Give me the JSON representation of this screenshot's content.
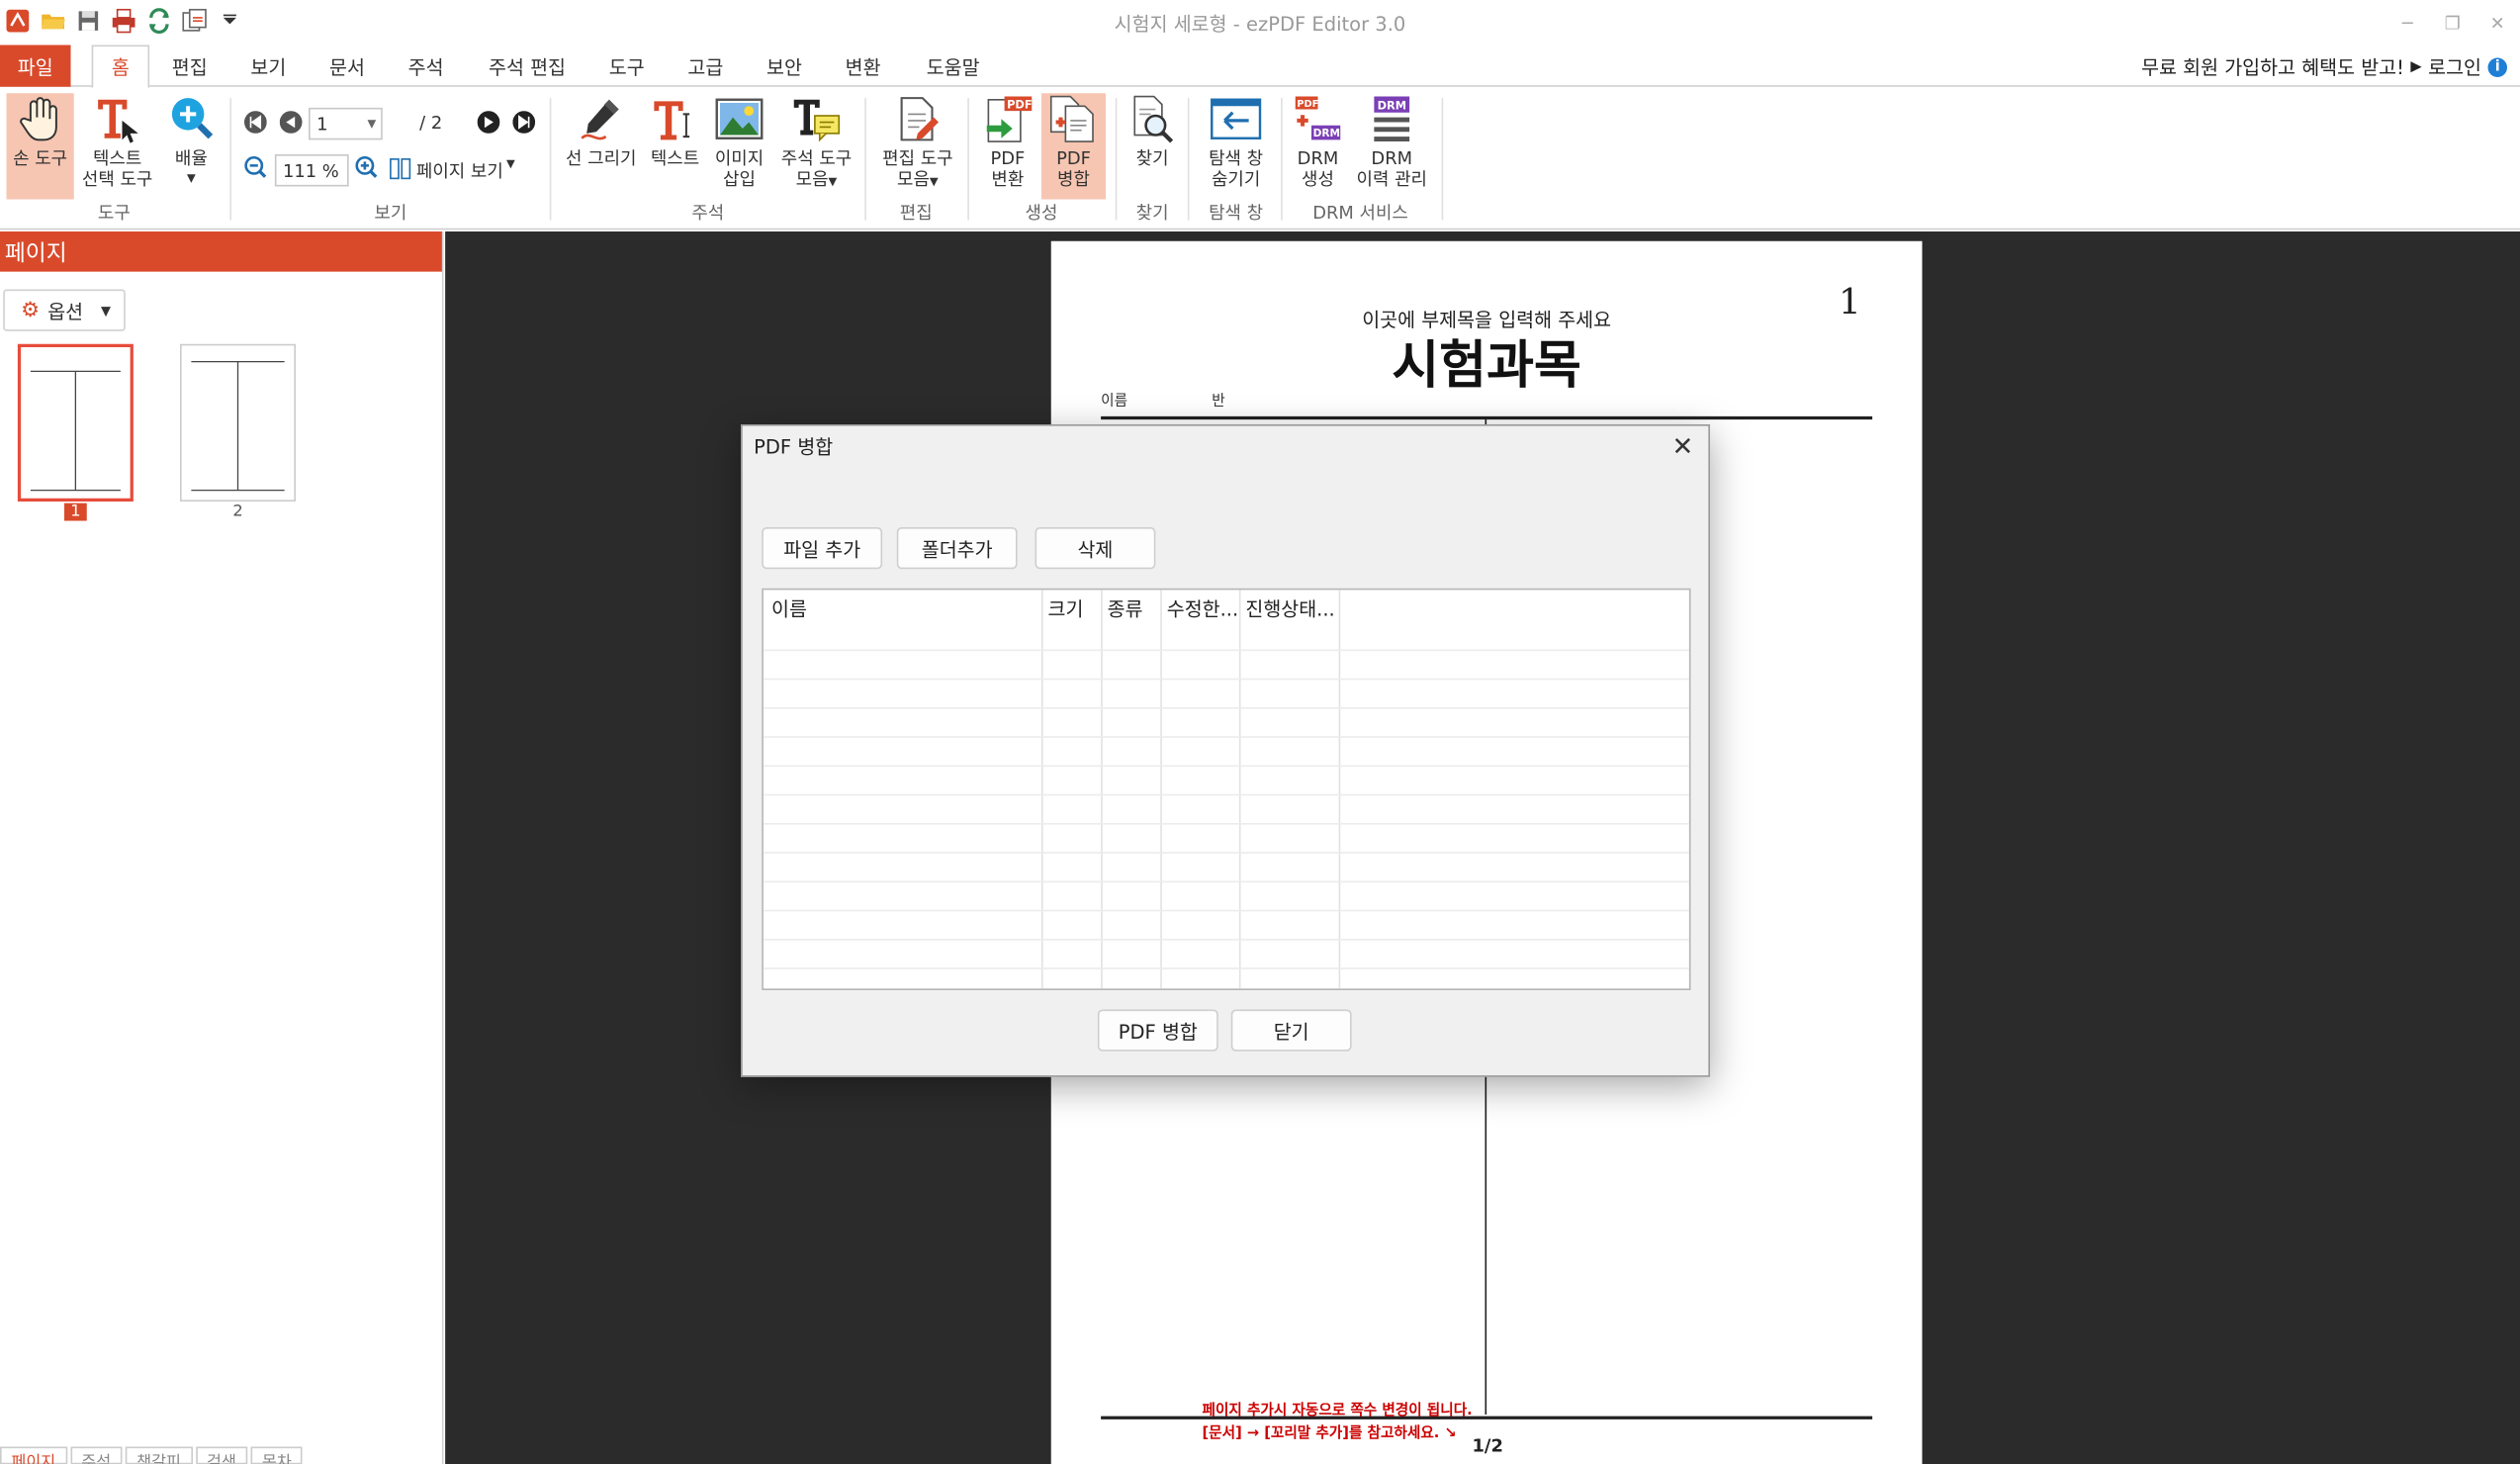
{
  "window": {
    "title": "시험지 세로형 - ezPDF Editor 3.0",
    "controls": [
      "minimize",
      "restore",
      "close"
    ]
  },
  "quick_access": [
    "app-logo-icon",
    "open-folder-icon",
    "save-icon",
    "print-icon",
    "refresh-icon",
    "convert-icon",
    "dropdown-icon"
  ],
  "tabs": [
    "파일",
    "홈",
    "편집",
    "보기",
    "문서",
    "주석",
    "주석 편집",
    "도구",
    "고급",
    "보안",
    "변환",
    "도움말"
  ],
  "active_tab": "홈",
  "promo": "무료 회원 가입하고 혜택도 받고!",
  "promo_arrow": "▶",
  "login": "로그인",
  "ribbon": {
    "hand_tool": "손 도구",
    "text_select_1": "텍스트",
    "text_select_2": "선택 도구",
    "zoom_1": "배율",
    "group_tool": "도구",
    "page_input": "1",
    "page_total": "/ 2",
    "zoom_value": "111 %",
    "page_view": "페이지 보기",
    "group_view": "보기",
    "draw_line": "선 그리기",
    "text": "텍스트",
    "image_1": "이미지",
    "image_2": "삽입",
    "annot_tools_1": "주석 도구",
    "annot_tools_2": "모음",
    "group_annot": "주석",
    "edit_tools_1": "편집 도구",
    "edit_tools_2": "모음",
    "group_edit": "편집",
    "pdf_convert_1": "PDF",
    "pdf_convert_2": "변환",
    "pdf_merge_1": "PDF",
    "pdf_merge_2": "병합",
    "group_create": "생성",
    "find": "찾기",
    "group_find": "찾기",
    "hide_nav_1": "탐색 창",
    "hide_nav_2": "숨기기",
    "group_nav": "탐색 창",
    "drm_create_1": "DRM",
    "drm_create_2": "생성",
    "drm_history_1": "DRM",
    "drm_history_2": "이력 관리",
    "group_drm": "DRM 서비스"
  },
  "left_panel": {
    "title": "페이지",
    "options": "옵션",
    "thumbnails": [
      "1",
      "2"
    ],
    "selected_page": "1",
    "bottom_tabs": [
      "페이지",
      "주석",
      "책갈피",
      "검색",
      "목차"
    ]
  },
  "document": {
    "subtitle": "이곳에 부제목을 입력해 주세요",
    "title": "시험과목",
    "page_number": "1",
    "name_label": "이름",
    "class_label": "반",
    "footnote_1": "페이지 추가시 자동으로 쪽수 변경이 됩니다.",
    "footnote_2": "[문서] → [꼬리말 추가]를 참고하세요. ↘",
    "footer_page": "1/2"
  },
  "dialog": {
    "title": "PDF 병합",
    "close": "✕",
    "add_file": "파일 추가",
    "add_folder": "폴더추가",
    "delete": "삭제",
    "columns": [
      "이름",
      "크기",
      "종류",
      "수정한...",
      "진행상태..."
    ],
    "merge": "PDF 병합",
    "close_btn": "닫기"
  }
}
